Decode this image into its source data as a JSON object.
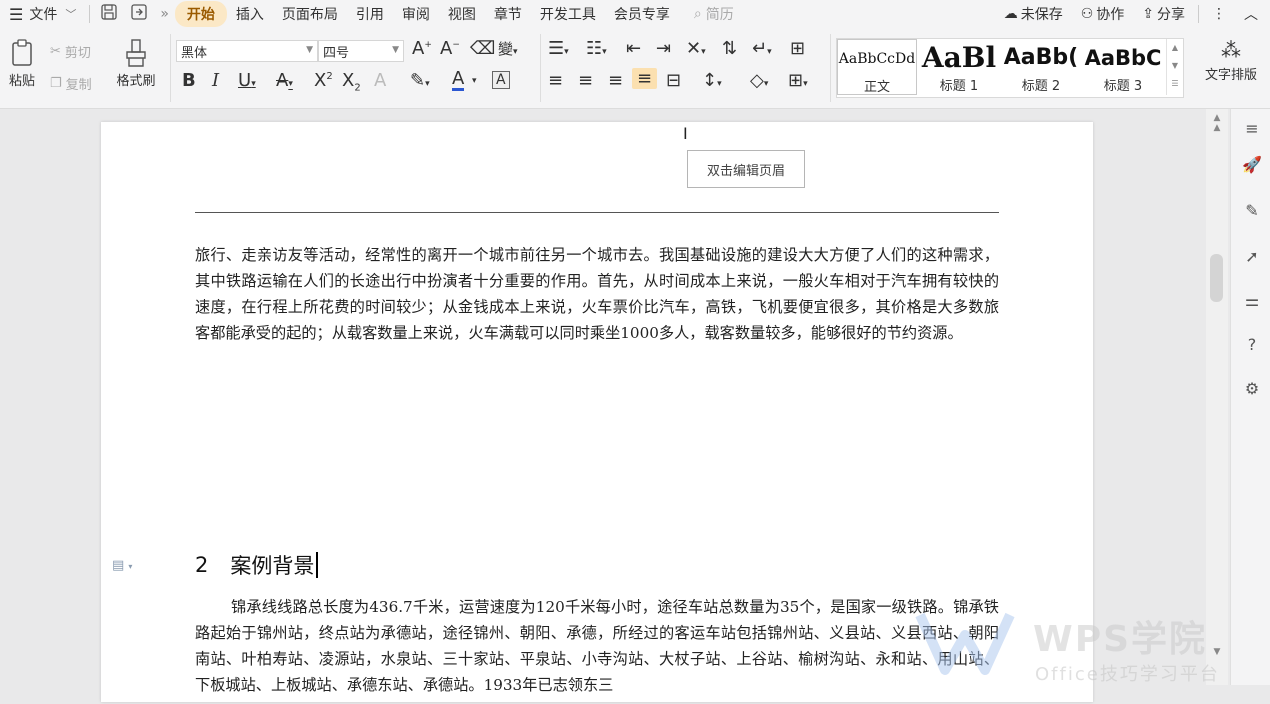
{
  "menubar": {
    "menu_file": "文件",
    "tabs": [
      "开始",
      "插入",
      "页面布局",
      "引用",
      "审阅",
      "视图",
      "章节",
      "开发工具",
      "会员专享"
    ],
    "search_placeholder": "简历",
    "unsaved": "未保存",
    "collab": "协作",
    "share": "分享"
  },
  "toolbar": {
    "paste": "粘贴",
    "cut": "剪切",
    "copy": "复制",
    "format_painter": "格式刷",
    "font_name": "黑体",
    "font_size": "四号",
    "text_layout": "文字排版",
    "styles": [
      {
        "preview": "AaBbCcDd",
        "name": "正文"
      },
      {
        "preview": "AaBl",
        "name": "标题 1"
      },
      {
        "preview": "AaBb(",
        "name": "标题 2"
      },
      {
        "preview": "AaBbC",
        "name": "标题 3"
      }
    ]
  },
  "document": {
    "header_button": "双击编辑页眉",
    "paragraph1": "旅行、走亲访友等活动，经常性的离开一个城市前往另一个城市去。我国基础设施的建设大大方便了人们的这种需求，其中铁路运输在人们的长途出行中扮演者十分重要的作用。首先，从时间成本上来说，一般火车相对于汽车拥有较快的速度，在行程上所花费的时间较少；从金钱成本上来说，火车票价比汽车，高铁，飞机要便宜很多，其价格是大多数旅客都能承受的起的；从载客数量上来说，火车满载可以同时乘坐1000多人，载客数量较多，能够很好的节约资源。",
    "heading_number": "2",
    "heading_text": "案例背景",
    "paragraph2": "锦承线线路总长度为436.7千米，运营速度为120千米每小时，途径车站总数量为35个，是国家一级铁路。锦承铁路起始于锦州站，终点站为承德站，途径锦州、朝阳、承德，所经过的客运车站包括锦州站、义县站、义县西站、朝阳南站、叶柏寿站、凌源站，水泉站、三十家站、平泉站、小寺沟站、大杖子站、上谷站、榆树沟站、永和站、用山站、下板城站、上板城站、承德东站、承德站。1933年已志领东三"
  },
  "watermark": {
    "brand": "WPS学院",
    "tagline": "Office技巧学习平台"
  },
  "colors": {
    "accent_tab_bg": "#fbe8c6",
    "accent_tab_text": "#9a5a00",
    "font_color_underline": "#2b57d1"
  }
}
